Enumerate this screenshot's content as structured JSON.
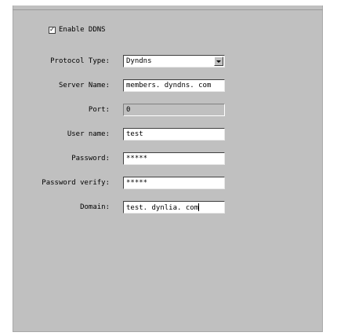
{
  "ddns": {
    "enable_label": "Enable DDNS",
    "enable_checked": true,
    "protocol_type": {
      "label": "Protocol Type:",
      "value": "Dyndns"
    },
    "server_name": {
      "label": "Server Name:",
      "value": "members. dyndns. com"
    },
    "port": {
      "label": "Port:",
      "value": "0"
    },
    "user_name": {
      "label": "User name:",
      "value": "test"
    },
    "password": {
      "label": "Password:",
      "value": "*****"
    },
    "password_verify": {
      "label": "Password verify:",
      "value": "*****"
    },
    "domain": {
      "label": "Domain:",
      "value": "test. dynlia. com"
    }
  },
  "icons": {
    "checkbox_mark": "check-icon",
    "dropdown": "chevron-down-icon"
  },
  "colors": {
    "panel_bg": "#c0c0c0",
    "field_bg": "#ffffff"
  }
}
